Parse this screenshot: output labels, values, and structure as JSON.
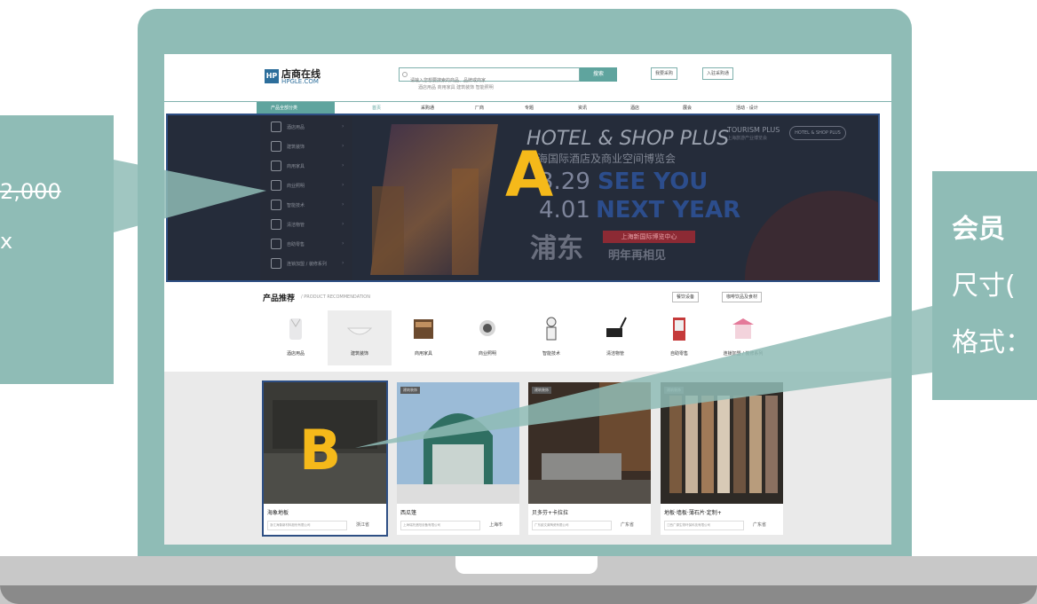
{
  "callouts": {
    "left_price": "2,000",
    "left_unit": "x",
    "right_title": "会员",
    "right_size": "尺寸(",
    "right_format": "格式："
  },
  "site": {
    "logo_mark": "HP",
    "logo_cn": "店商在线",
    "logo_en": "HPGLE.COM",
    "search_placeholder": "请输入您想要搜索的商品、品牌或商家",
    "search_button": "搜索",
    "hot_words": "酒店用品  商用家具  建筑装饰  智能照明",
    "btn_purchase": "我要采购",
    "btn_join": "入驻采购通"
  },
  "nav": {
    "all_categories": "产品全部分类",
    "items": [
      "首页",
      "采购通",
      "厂商",
      "专题",
      "资讯",
      "酒店",
      "展会",
      "活动 · 设计"
    ]
  },
  "sidebar": {
    "items": [
      "酒店用品",
      "建筑装饰",
      "商用家具",
      "商业照明",
      "智能技术",
      "清洁物管",
      "自助零售",
      "连锁加盟 / 装修系列"
    ]
  },
  "banner": {
    "title": "HOTEL & SHOP PLUS",
    "subtitle": "上海国际酒店及商业空间博览会",
    "date1": "3.29",
    "date2": "4.01",
    "see_you": "SEE YOU",
    "next_year": "NEXT YEAR",
    "pudong": "浦东",
    "red_strip": "上海新国际博览中心",
    "meet_again": "明年再相见",
    "tourism": "TOURISM PLUS",
    "tourism_sub": "上海旅游产业博览会",
    "hotelshop": "HOTEL & SHOP PLUS",
    "label": "A"
  },
  "recommend": {
    "title": "产品推荐",
    "subtitle": "/ PRODUCT RECOMMENDATION",
    "tag1": "餐饮设备",
    "tag2": "咖啡饮品及食材",
    "products": [
      "酒店用品",
      "建筑装饰",
      "商用家具",
      "商业照明",
      "智能技术",
      "清洁物管",
      "自助零售",
      "连锁加盟 / 装修系列"
    ]
  },
  "cards": [
    {
      "tag": "",
      "title": "海象地板",
      "company": "浙江海象新材料股份有限公司",
      "location": "浙江省",
      "label": "B"
    },
    {
      "tag": "建筑装饰",
      "title": "西瓜篷",
      "company": "上海瑞托遮阳设备有限公司",
      "location": "上海市"
    },
    {
      "tag": "建筑装饰",
      "title": "贝多芬+卡拉拉",
      "company": "广东欧文莱陶瓷有限公司",
      "location": "广东省"
    },
    {
      "tag": "建筑装饰",
      "title": "地板·墙板·薄石片·定制+",
      "company": "江西广源生物环保科技有限公司",
      "location": "广东省"
    }
  ],
  "colors": {
    "frame": "#8fbcb6",
    "accent": "#5fa49e",
    "banner_bg": "#252c3a",
    "highlight": "#f5b91a"
  }
}
